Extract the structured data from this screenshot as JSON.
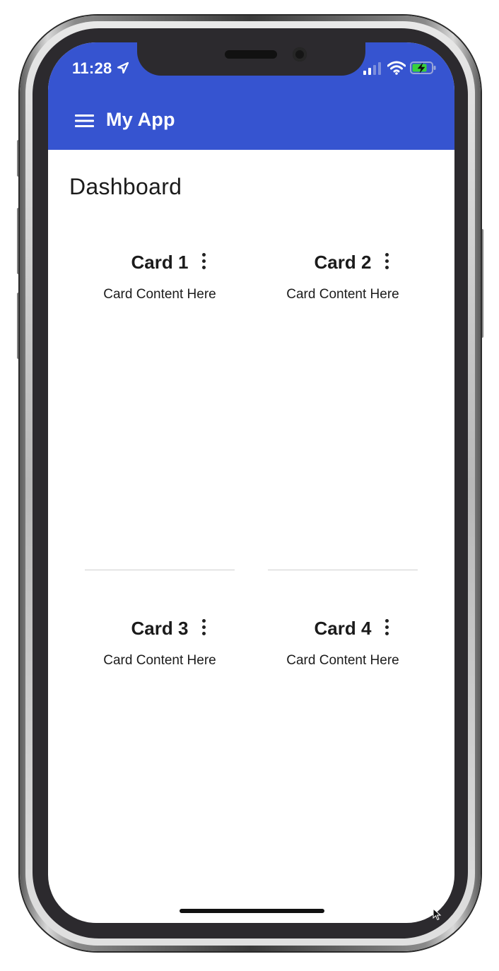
{
  "status_bar": {
    "time": "11:28"
  },
  "app_bar": {
    "title": "My App",
    "color": "#3654d0"
  },
  "page": {
    "title": "Dashboard"
  },
  "cards": [
    {
      "title": "Card 1",
      "content": "Card Content Here"
    },
    {
      "title": "Card 2",
      "content": "Card Content Here"
    },
    {
      "title": "Card 3",
      "content": "Card Content Here"
    },
    {
      "title": "Card 4",
      "content": "Card Content Here"
    }
  ],
  "icons": {
    "menu": "hamburger-menu-icon",
    "location": "location-arrow-icon",
    "signal": "cellular-signal-icon",
    "wifi": "wifi-icon",
    "battery": "battery-charging-icon",
    "card_menu": "more-vertical-icon"
  }
}
